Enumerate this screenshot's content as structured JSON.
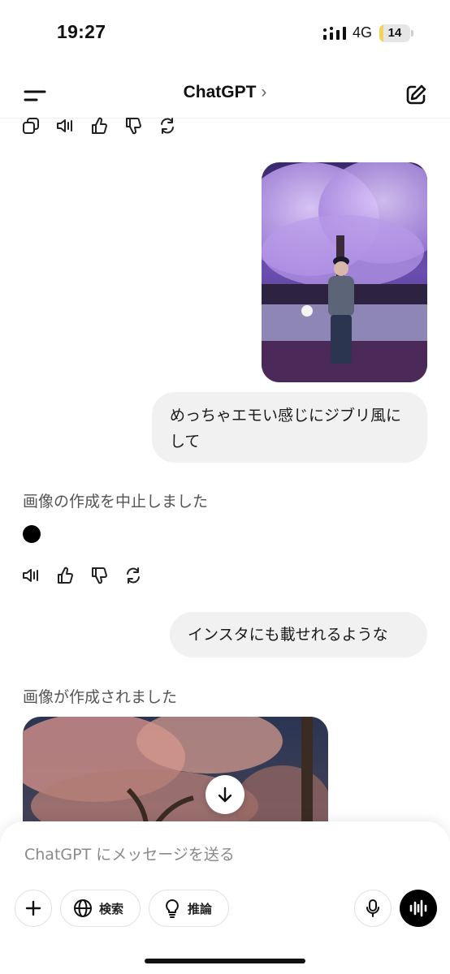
{
  "status_bar": {
    "time": "19:27",
    "network": "4G",
    "battery": "14",
    "battery_level_percent": 14,
    "battery_color": "#f2d35b"
  },
  "nav": {
    "title": "ChatGPT",
    "chevron": "›",
    "menu_icon": "menu-icon",
    "edit_icon": "new-chat-icon"
  },
  "messages": {
    "user_message_1": "めっちゃエモい感じにジブリ風にして",
    "assistant_status_1": "画像の作成を中止しました",
    "user_message_2": "インスタにも載せれるような",
    "assistant_status_2": "画像が作成されました"
  },
  "message_actions": {
    "top": [
      "copy-icon",
      "speaker-icon",
      "thumbs-up-icon",
      "thumbs-down-icon",
      "regenerate-icon"
    ],
    "middle": [
      "speaker-icon",
      "thumbs-up-icon",
      "thumbs-down-icon",
      "regenerate-icon"
    ]
  },
  "composer": {
    "placeholder": "ChatGPT にメッセージを送る",
    "search_label": "検索",
    "reason_label": "推論"
  },
  "colors": {
    "bubble_bg": "#f1f1f1",
    "accent_dark": "#000000"
  }
}
